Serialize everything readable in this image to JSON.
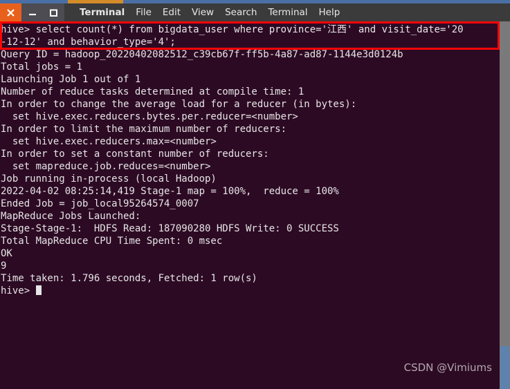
{
  "window": {
    "controls": [
      {
        "name": "close",
        "glyph": "X"
      },
      {
        "name": "minimize",
        "glyph": "_"
      },
      {
        "name": "maximize",
        "glyph": "[]"
      }
    ],
    "menu": [
      "Terminal",
      "File",
      "Edit",
      "View",
      "Search",
      "Terminal",
      "Help"
    ],
    "app_name": "Terminal"
  },
  "colors": {
    "terminal_background": "#2d0a24",
    "titlebar_background": "#3b3b3b",
    "close_button": "#e8611c",
    "annotation_box": "#fb0505",
    "scrollbar_thumb": "#5d82ad",
    "text": "#e6e6e6"
  },
  "terminal": {
    "lines": [
      "hive> select count(*) from bigdata_user where province='江西' and visit_date='20",
      "-12-12' and behavior_type='4';",
      "Query ID = hadoop_20220402082512_c39cb67f-ff5b-4a87-ad87-1144e3d0124b",
      "Total jobs = 1",
      "Launching Job 1 out of 1",
      "Number of reduce tasks determined at compile time: 1",
      "In order to change the average load for a reducer (in bytes):",
      "  set hive.exec.reducers.bytes.per.reducer=<number>",
      "In order to limit the maximum number of reducers:",
      "  set hive.exec.reducers.max=<number>",
      "In order to set a constant number of reducers:",
      "  set mapreduce.job.reduces=<number>",
      "Job running in-process (local Hadoop)",
      "2022-04-02 08:25:14,419 Stage-1 map = 100%,  reduce = 100%",
      "Ended Job = job_local95264574_0007",
      "MapReduce Jobs Launched:",
      "Stage-Stage-1:  HDFS Read: 187090280 HDFS Write: 0 SUCCESS",
      "Total MapReduce CPU Time Spent: 0 msec",
      "OK",
      "9",
      "Time taken: 1.796 seconds, Fetched: 1 row(s)"
    ],
    "prompt": "hive> ",
    "cursor_visible": true
  },
  "annotation": {
    "highlighted_command": "hive> select count(*) from bigdata_user where province='江西' and visit_date='2020-12-12' and behavior_type='4';"
  },
  "watermark": {
    "text": "CSDN @Vimiums"
  }
}
